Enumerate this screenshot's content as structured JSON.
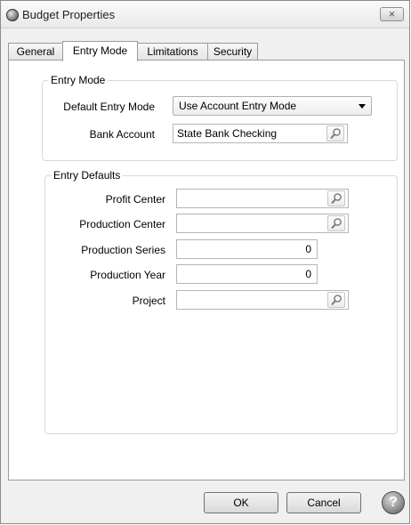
{
  "window": {
    "title": "Budget Properties",
    "close_glyph": "×"
  },
  "tabs": [
    {
      "label": "General",
      "active": false
    },
    {
      "label": "Entry Mode",
      "active": true
    },
    {
      "label": "Limitations",
      "active": false
    },
    {
      "label": "Security",
      "active": false
    }
  ],
  "entry_mode": {
    "legend": "Entry Mode",
    "default_entry_mode_label": "Default Entry Mode",
    "default_entry_mode_value": "Use Account Entry Mode",
    "bank_account_label": "Bank Account",
    "bank_account_value": "State Bank Checking"
  },
  "entry_defaults": {
    "legend": "Entry Defaults",
    "profit_center_label": "Profit Center",
    "profit_center_value": "",
    "production_center_label": "Production Center",
    "production_center_value": "",
    "production_series_label": "Production Series",
    "production_series_value": "0",
    "production_year_label": "Production Year",
    "production_year_value": "0",
    "project_label": "Project",
    "project_value": ""
  },
  "footer": {
    "ok_label": "OK",
    "cancel_label": "Cancel",
    "help_glyph": "?"
  },
  "icons": [
    "app-icon",
    "close-icon",
    "search-icon",
    "dropdown-arrow-icon",
    "help-icon"
  ]
}
